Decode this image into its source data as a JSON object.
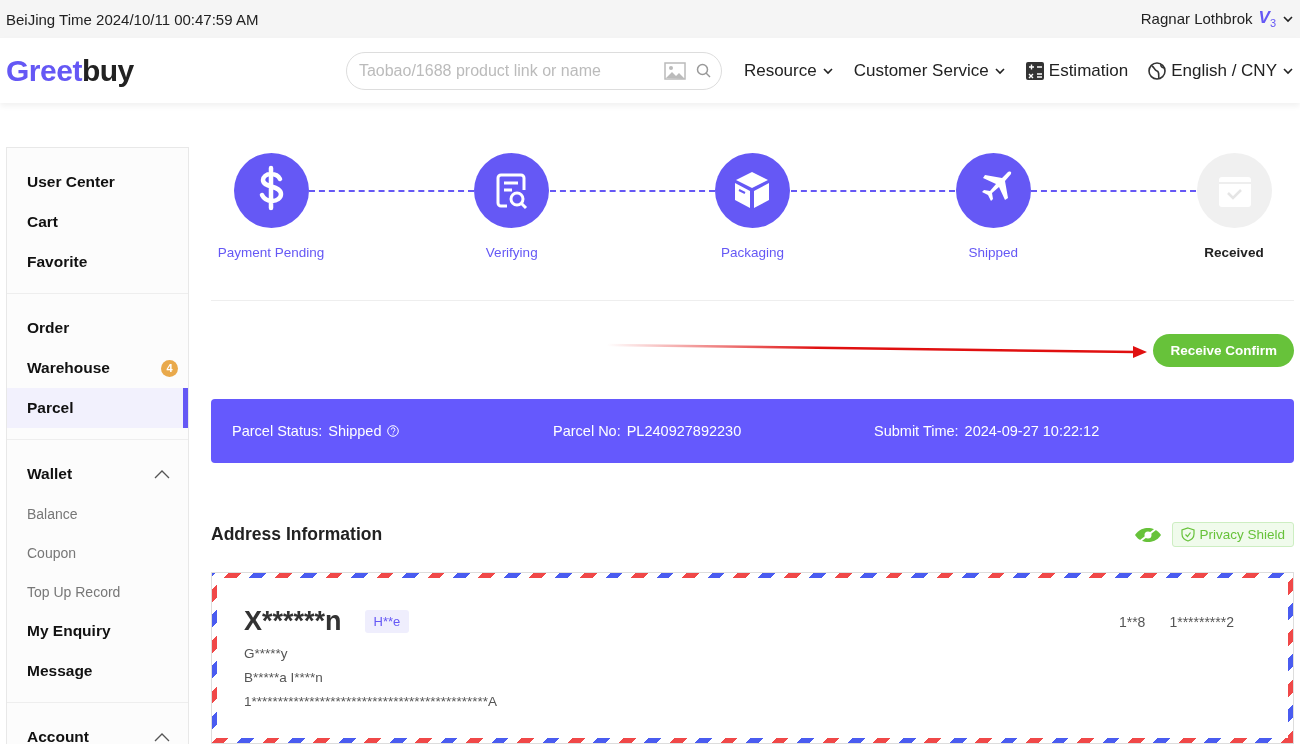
{
  "top_bar": {
    "time": "BeiJing Time 2024/10/11 00:47:59 AM",
    "user": "Ragnar Lothbrok",
    "vip_letter": "V",
    "vip_level": "3"
  },
  "header": {
    "logo": {
      "first": "Greet",
      "second": "buy"
    },
    "search": {
      "placeholder": "Taobao/1688 product link or name"
    },
    "nav": [
      {
        "label": "Resource",
        "kind": "dropdown"
      },
      {
        "label": "Customer Service",
        "kind": "dropdown"
      },
      {
        "label": "Estimation",
        "kind": "tool"
      },
      {
        "label": "English / CNY",
        "kind": "language"
      }
    ]
  },
  "sidebar": {
    "groups": [
      {
        "items": [
          {
            "label": "User Center",
            "selected": false
          },
          {
            "label": "Cart",
            "selected": false
          },
          {
            "label": "Favorite",
            "selected": false
          }
        ]
      },
      {
        "items": [
          {
            "label": "Order",
            "selected": false
          },
          {
            "label": "Warehouse",
            "selected": false,
            "badge": "4"
          },
          {
            "label": "Parcel",
            "selected": true
          }
        ]
      },
      {
        "title": "Wallet",
        "expanded": true,
        "items": [
          {
            "label": "Balance",
            "kind": "sub",
            "selected": false
          },
          {
            "label": "Coupon",
            "kind": "sub",
            "selected": false
          },
          {
            "label": "Top Up Record",
            "kind": "sub",
            "selected": false
          },
          {
            "label": "My Enquiry",
            "kind": "main",
            "selected": false
          },
          {
            "label": "Message",
            "kind": "main",
            "selected": false
          }
        ]
      },
      {
        "title": "Account",
        "expanded": true
      }
    ]
  },
  "steps": [
    {
      "label": "Payment Pending",
      "kind": "payment",
      "done": true
    },
    {
      "label": "Verifying",
      "kind": "verify",
      "done": true
    },
    {
      "label": "Packaging",
      "kind": "package",
      "done": true
    },
    {
      "label": "Shipped",
      "kind": "ship",
      "done": true
    },
    {
      "label": "Received",
      "kind": "receive",
      "done": false
    }
  ],
  "receive_button": "Receive Confirm",
  "parcel": {
    "fields": [
      {
        "label": "Parcel Status:",
        "value": "Shipped",
        "help": true
      },
      {
        "label": "Parcel No:",
        "value": "PL240927892230",
        "help": false
      },
      {
        "label": "Submit Time:",
        "value": "2024-09-27 10:22:12",
        "help": false
      }
    ]
  },
  "address": {
    "title": "Address Information",
    "privacy_shield": "Privacy Shield",
    "name": "X******n",
    "tag": "H**e",
    "phone_code": "1**8",
    "phone": "1*********2",
    "lines": [
      "G*****y",
      "B*****a I****n",
      "1*********************************************A"
    ]
  }
}
